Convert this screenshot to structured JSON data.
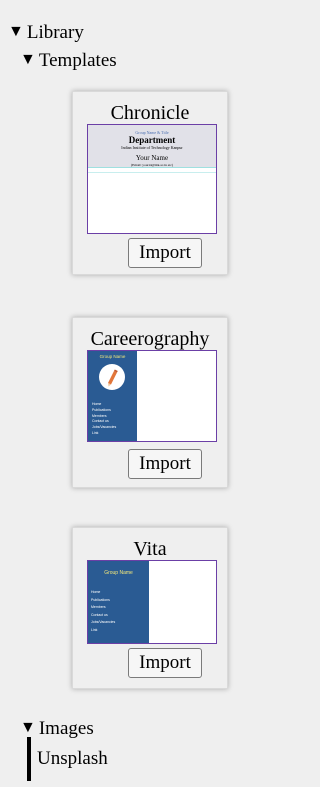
{
  "tree": {
    "library_label": "Library",
    "templates_label": "Templates",
    "images_label": "Images",
    "unsplash_label": "Unsplash",
    "expanded_glyph": "▼"
  },
  "templates": [
    {
      "name": "Chronicle",
      "import_label": "Import",
      "preview": {
        "group_line": "Group Name & Title",
        "department": "Department",
        "institute": "Indian Institute of Technology Kanpur",
        "your_name": "Your Name",
        "email": "(Email: yourid@iitk.ac.in etc)"
      }
    },
    {
      "name": "Careerography",
      "import_label": "Import",
      "preview": {
        "group_name": "Group Name",
        "nav": [
          "Home",
          "Publications",
          "Members",
          "Contact us",
          "Jobs/Vacancies",
          "Link"
        ]
      }
    },
    {
      "name": "Vita",
      "import_label": "Import",
      "preview": {
        "group_name": "Group Name",
        "nav": [
          "Home",
          "Publications",
          "Members",
          "Contact us",
          "Jobs/Vacancies",
          "Link"
        ]
      }
    }
  ],
  "colors": {
    "background": "#efefef",
    "sidebar_blue": "#2a5b93",
    "group_name_yellow": "#f2e77a",
    "thumb_border": "#6b3fa6"
  }
}
